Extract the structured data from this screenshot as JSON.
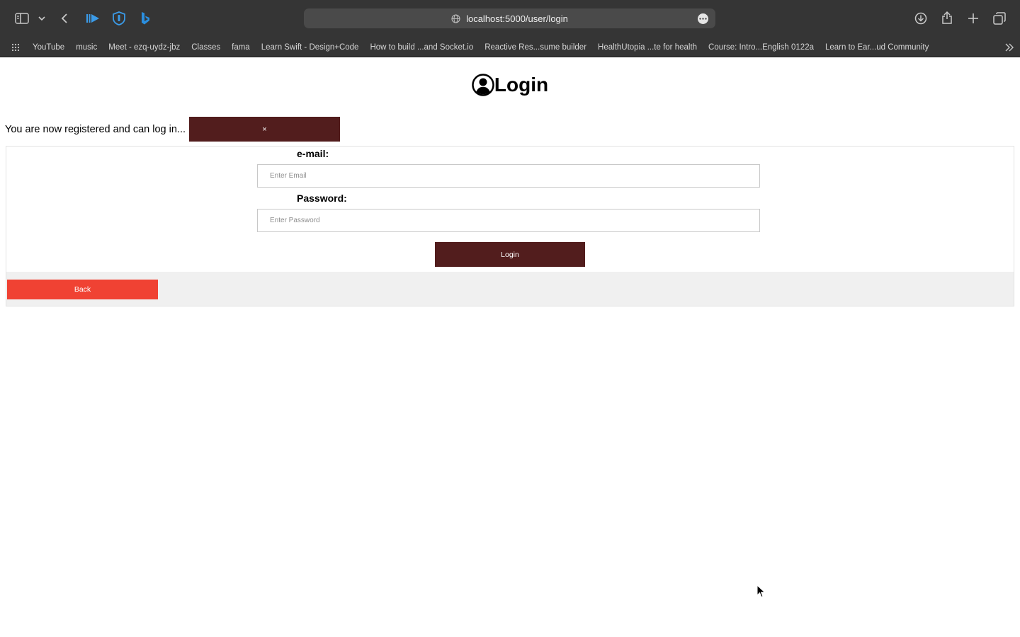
{
  "browser": {
    "url": "localhost:5000/user/login",
    "bookmarks": [
      "YouTube",
      "music",
      "Meet - ezq-uydz-jbz",
      "Classes",
      "fama",
      "Learn Swift - Design+Code",
      "How to build ...and Socket.io",
      "Reactive Res...sume builder",
      "HealthUtopia ...te for health",
      "Course: Intro...English 0122a",
      "Learn to Ear...ud Community"
    ]
  },
  "page": {
    "title": "Login",
    "flash": {
      "message": "You are now registered and can log in...",
      "close_label": "×"
    },
    "form": {
      "email_label": "e-mail:",
      "email_placeholder": "Enter Email",
      "password_label": "Password:",
      "password_placeholder": "Enter Password",
      "submit_label": "Login"
    },
    "back_label": "Back"
  },
  "colors": {
    "toolbar": "#353535",
    "primary_button": "#521d1d",
    "back_button": "#f04233",
    "form_footer": "#f0f0f0"
  }
}
